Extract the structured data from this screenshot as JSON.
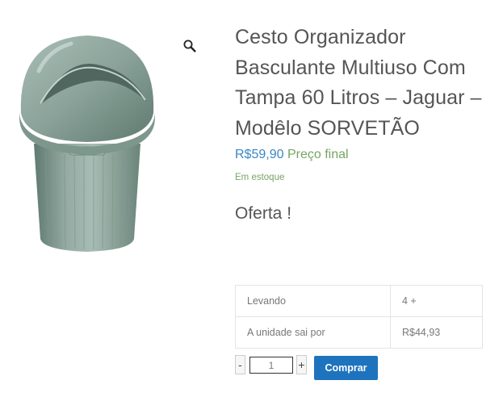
{
  "product": {
    "title": "Cesto Organizador Basculante Multiuso Com Tampa 60 Litros – Jaguar – Modêlo SORVETÃO",
    "price": "R$59,90",
    "price_suffix": "Preço final",
    "stock": "Em estoque",
    "offer": "Oferta !",
    "image_icon": "zoom-magnifier-icon",
    "image_subject": "green-dome-lid-waste-bin"
  },
  "tiers": [
    {
      "label": "Levando",
      "value": "4 +"
    },
    {
      "label": "A unidade sai por",
      "value": "R$44,93"
    }
  ],
  "cart": {
    "minus": "-",
    "plus": "+",
    "quantity": "1",
    "button": "Comprar"
  },
  "colors": {
    "accent": "#1e73be",
    "price": "#3a87c4",
    "stock": "#77a464",
    "product": "#8fa59d"
  }
}
